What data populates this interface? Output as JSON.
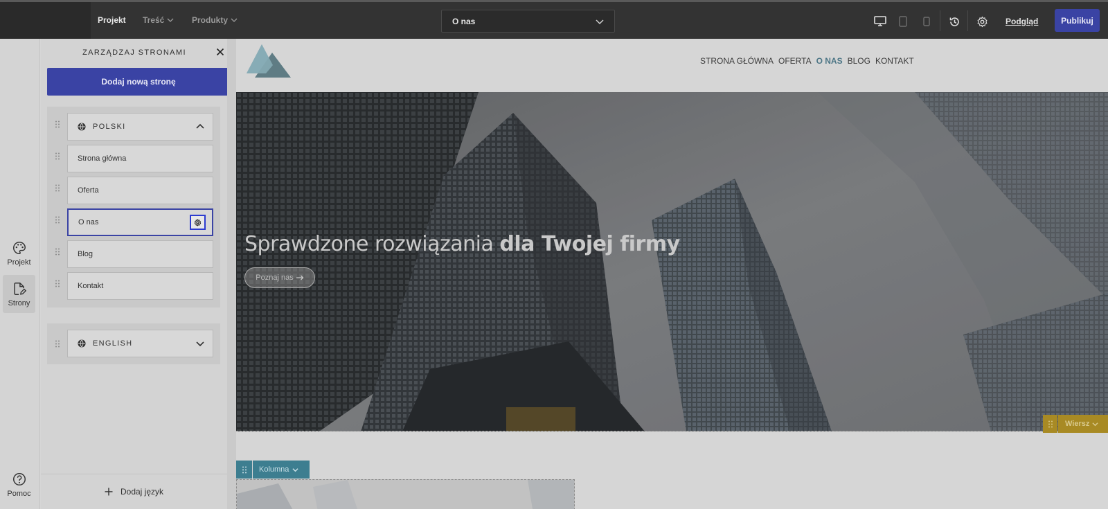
{
  "topbar": {
    "nav": [
      {
        "label": "Projekt",
        "active": true,
        "dropdown": false
      },
      {
        "label": "Treść",
        "active": false,
        "dropdown": true
      },
      {
        "label": "Produkty",
        "active": false,
        "dropdown": true
      }
    ],
    "page_select": {
      "value": "O nas"
    },
    "icons": [
      "desktop-icon",
      "tablet-icon",
      "mobile-icon",
      "history-icon",
      "gear-icon"
    ],
    "preview_label": "Podgląd",
    "publish_label": "Publikuj",
    "colors": {
      "bar": "#333333",
      "accent": "#3a43a4"
    }
  },
  "rail": {
    "items": [
      {
        "label": "Projekt",
        "icon": "palette-icon",
        "active": false
      },
      {
        "label": "Strony",
        "icon": "page-edit-icon",
        "active": true
      },
      {
        "label": "Pomoc",
        "icon": "help-icon",
        "active": false
      }
    ]
  },
  "panel": {
    "title": "ZARZĄDZAJ STRONAMI",
    "add_page_label": "Dodaj nową stronę",
    "languages": [
      {
        "name": "POLSKI",
        "expanded": true,
        "pages": [
          {
            "label": "Strona główna",
            "selected": false
          },
          {
            "label": "Oferta",
            "selected": false
          },
          {
            "label": "O nas",
            "selected": true
          },
          {
            "label": "Blog",
            "selected": false
          },
          {
            "label": "Kontakt",
            "selected": false
          }
        ]
      },
      {
        "name": "ENGLISH",
        "expanded": false,
        "pages": []
      }
    ],
    "add_language_label": "Dodaj język"
  },
  "site": {
    "menu": [
      {
        "label": "STRONA GŁÓWNA",
        "current": false
      },
      {
        "label": "OFERTA",
        "current": false
      },
      {
        "label": "O NAS",
        "current": true
      },
      {
        "label": "BLOG",
        "current": false
      },
      {
        "label": "KONTAKT",
        "current": false
      }
    ],
    "hero": {
      "title_light": "Sprawdzone rozwiązania ",
      "title_bold": "dla Twojej firmy",
      "button_label": "Poznaj nas"
    },
    "row_tag": "Wiersz",
    "column_tag": "Kolumna"
  }
}
